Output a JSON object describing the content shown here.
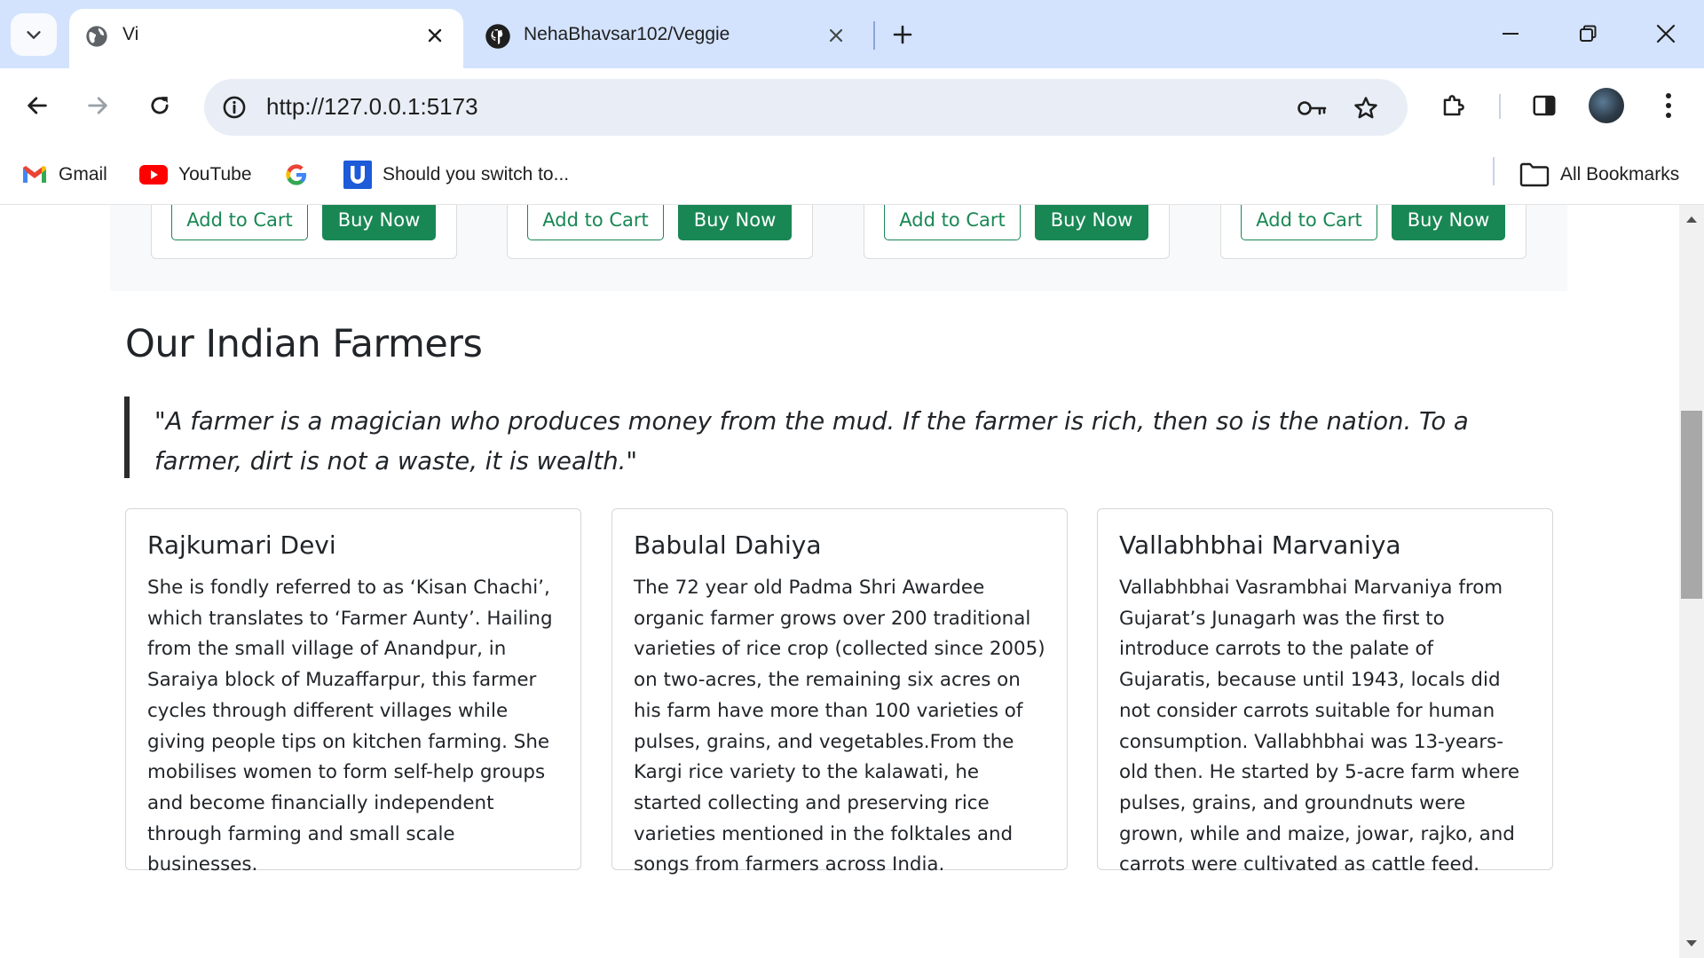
{
  "browser": {
    "tabs": [
      {
        "title": "Vi",
        "active": true,
        "icon": "globe-icon"
      },
      {
        "title": "NehaBhavsar102/Veggie",
        "active": false,
        "icon": "github-icon"
      }
    ],
    "url": "http://127.0.0.1:5173",
    "bookmarks": [
      {
        "label": "Gmail",
        "icon": "gmail-icon"
      },
      {
        "label": "YouTube",
        "icon": "youtube-icon"
      },
      {
        "label": "",
        "icon": "google-icon"
      },
      {
        "label": "Should you switch to...",
        "icon": "udemy-icon"
      }
    ],
    "all_bookmarks_label": "All Bookmarks"
  },
  "products": {
    "add_to_cart_label": "Add to Cart",
    "buy_now_label": "Buy Now",
    "count": 4
  },
  "farmers_section": {
    "title": "Our Indian Farmers",
    "quote": "\"A farmer is a magician who produces money from the mud. If the farmer is rich, then so is the nation. To a farmer, dirt is not a waste, it is wealth.\"",
    "farmers": [
      {
        "name": "Rajkumari Devi",
        "description": "She is fondly referred to as ‘Kisan Chachi’, which translates to ‘Farmer Aunty’. Hailing from the small village of Anandpur, in Saraiya block of Muzaffarpur, this farmer cycles through different villages while giving people tips on kitchen farming. She mobilises women to form self-help groups and become financially independent through farming and small scale businesses."
      },
      {
        "name": "Babulal Dahiya",
        "description": "The 72 year old Padma Shri Awardee organic farmer grows over 200 traditional varieties of rice crop (collected since 2005) on two-acres, the remaining six acres on his farm have more than 100 varieties of pulses, grains, and vegetables.From the Kargi rice variety to the kalawati, he started collecting and preserving rice varieties mentioned in the folktales and songs from farmers across India."
      },
      {
        "name": "Vallabhbhai Marvaniya",
        "description": "Vallabhbhai Vasrambhai Marvaniya from Gujarat’s Junagarh was the first to introduce carrots to the palate of Gujaratis, because until 1943, locals did not consider carrots suitable for human consumption. Vallabhbhai was 13-years-old then. He started by 5-acre farm where pulses, grains, and groundnuts were grown, while and maize, jowar, rajko, and carrots were cultivated as cattle feed."
      }
    ]
  },
  "colors": {
    "primary_green": "#198754",
    "tabbar_bg": "#d3e3fd",
    "omnibox_bg": "#e9eef6",
    "text": "#212529"
  }
}
